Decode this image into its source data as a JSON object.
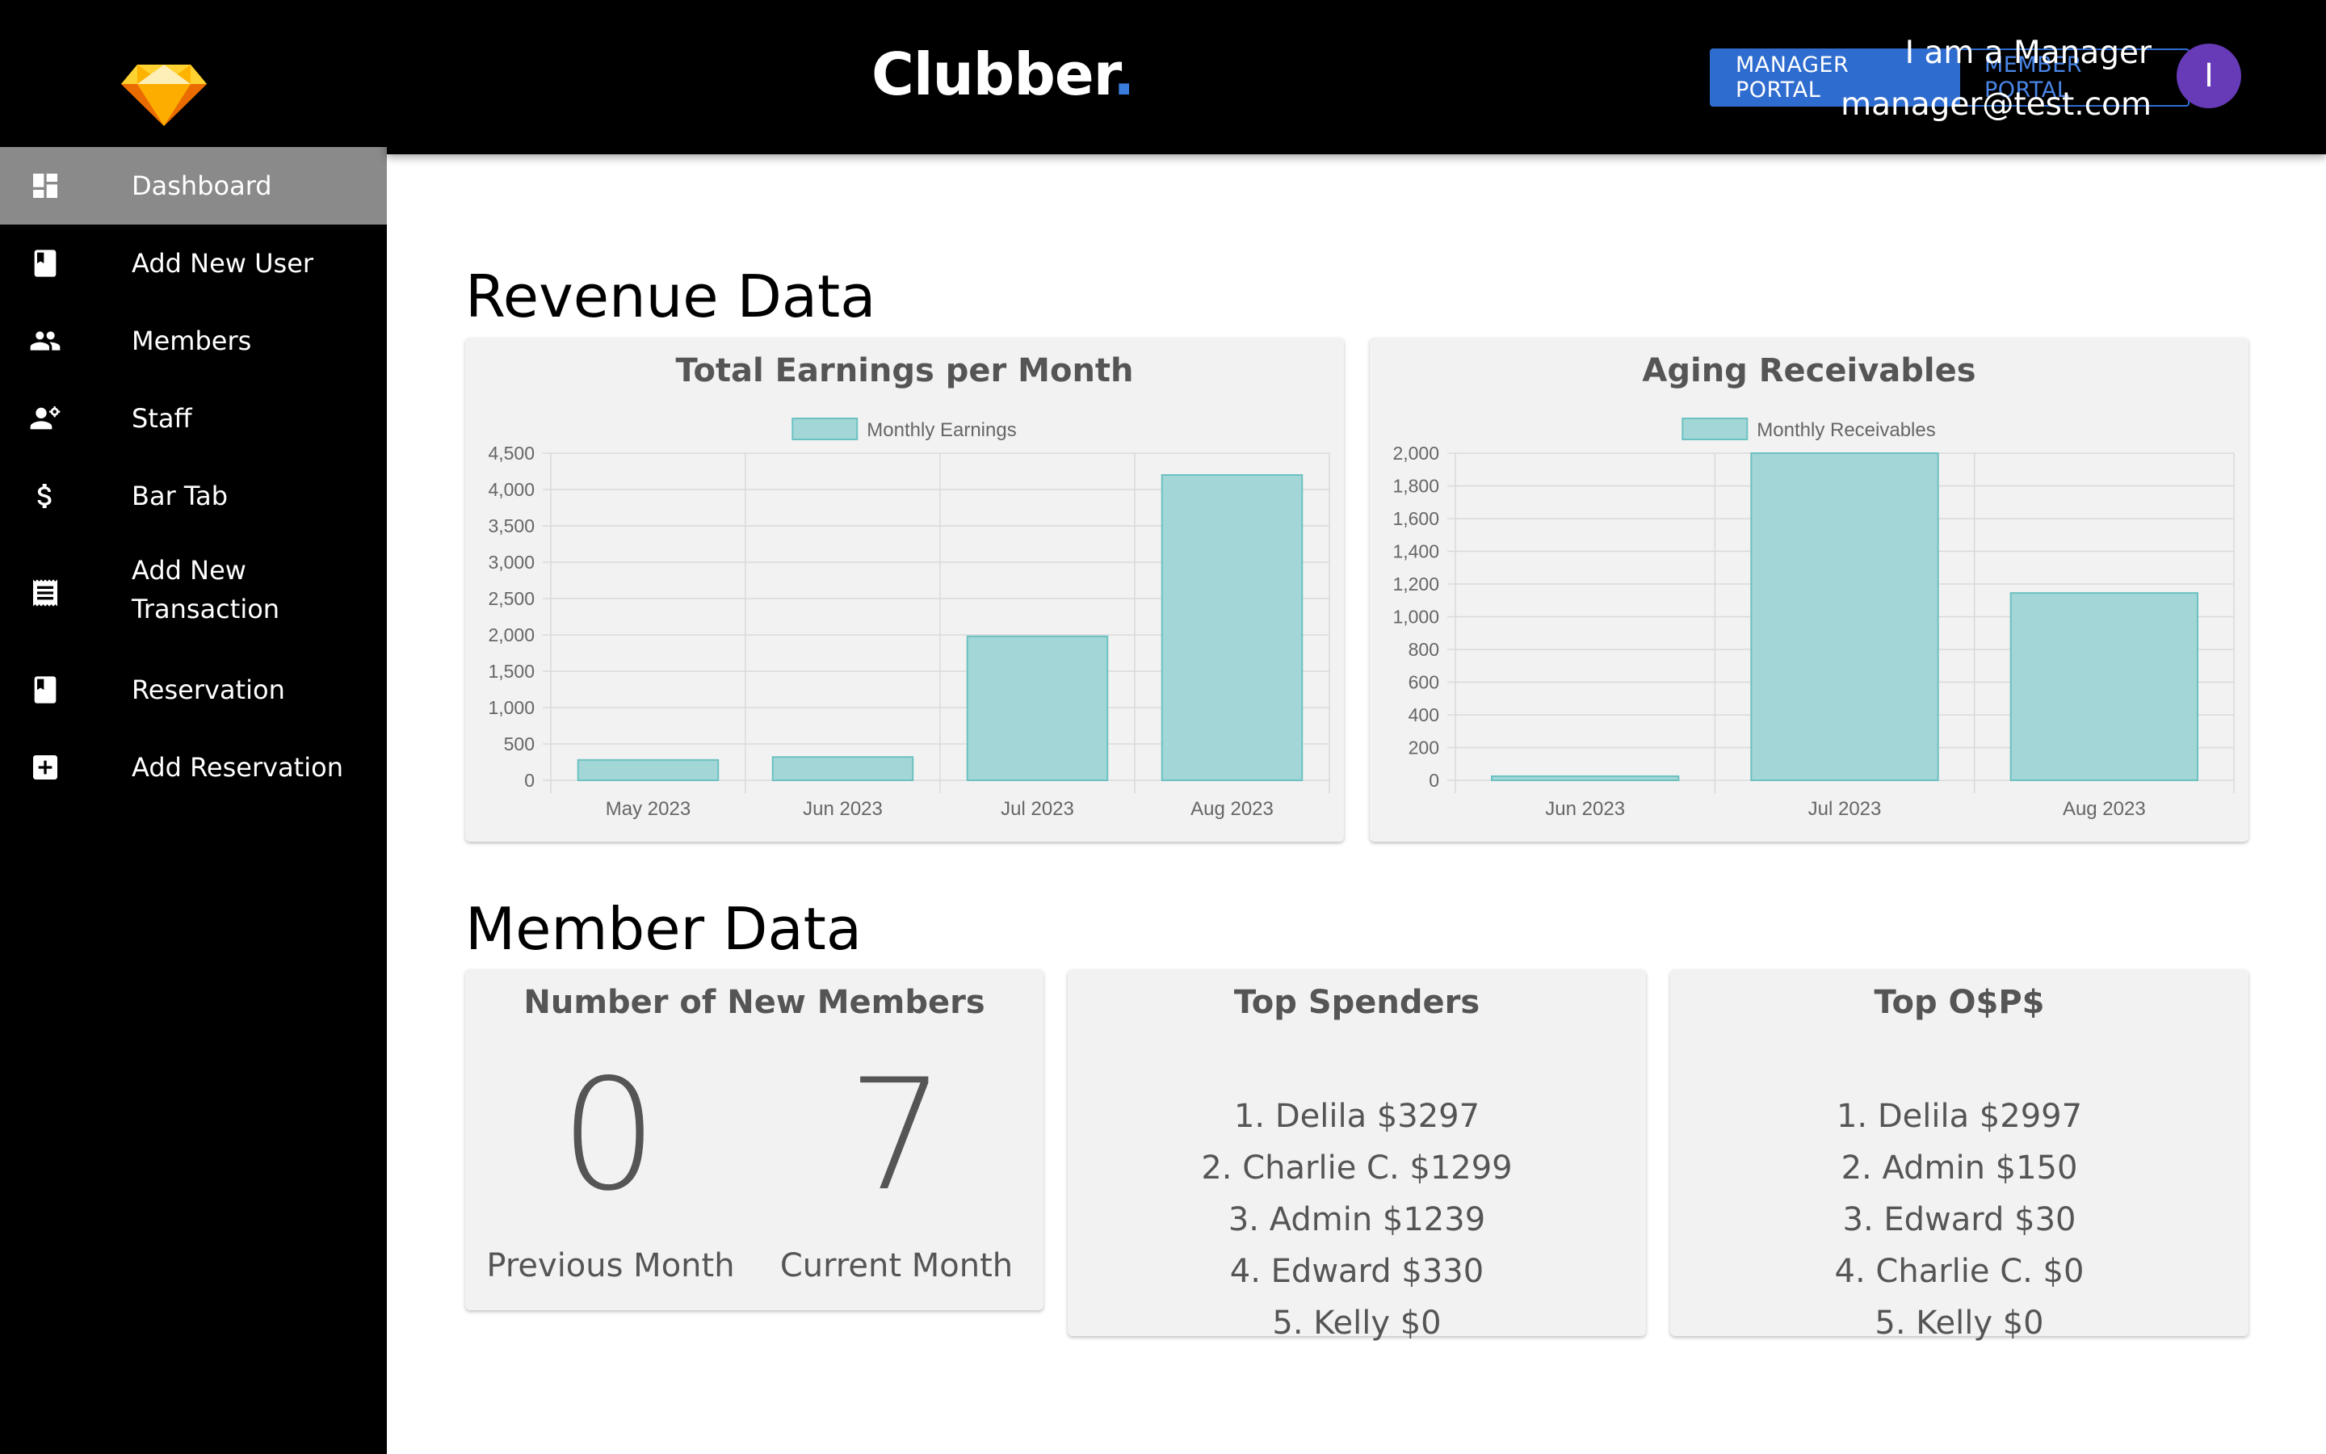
{
  "app": {
    "brand": "Clubber",
    "brand_dot": "."
  },
  "sidebar": {
    "items": [
      {
        "label": "Dashboard",
        "icon": "dashboard-icon",
        "active": true
      },
      {
        "label": "Add New User",
        "icon": "book-icon"
      },
      {
        "label": "Members",
        "icon": "people-icon"
      },
      {
        "label": "Staff",
        "icon": "staff-icon"
      },
      {
        "label": "Bar Tab",
        "icon": "dollar-icon"
      },
      {
        "label": "Add New",
        "label2": "Transaction",
        "icon": "receipt-icon"
      },
      {
        "label": "Reservation",
        "icon": "book-icon"
      },
      {
        "label": "Add Reservation",
        "icon": "plus-box-icon"
      }
    ]
  },
  "header": {
    "manager_portal": "MANAGER PORTAL",
    "member_portal": "MEMBER PORTAL",
    "user_name": "I am a Manager",
    "user_email": "manager@test.com",
    "avatar_initial": "I"
  },
  "colors": {
    "accent": "#2f6ccf",
    "avatar": "#673ab7",
    "bar_fill": "#a3d6d6",
    "bar_stroke": "#6cc1c1"
  },
  "revenue": {
    "section_title": "Revenue Data"
  },
  "member": {
    "section_title": "Member Data",
    "new_members": {
      "title": "Number of New Members",
      "previous_value": "0",
      "previous_label": "Previous Month",
      "current_value": "7",
      "current_label": "Current Month"
    },
    "top_spenders": {
      "title": "Top Spenders",
      "items": [
        "1. Delila $3297",
        "2. Charlie C. $1299",
        "3. Admin $1239",
        "4. Edward $330",
        "5. Kelly $0"
      ]
    },
    "top_osps": {
      "title": "Top O$P$",
      "items": [
        "1. Delila $2997",
        "2. Admin $150",
        "3. Edward $30",
        "4. Charlie C. $0",
        "5. Kelly $0"
      ]
    }
  },
  "chart_data": [
    {
      "type": "bar",
      "title": "Total Earnings per Month",
      "categories": [
        "May 2023",
        "Jun 2023",
        "Jul 2023",
        "Aug 2023"
      ],
      "series": [
        {
          "name": "Monthly Earnings",
          "values": [
            280,
            320,
            1980,
            4200
          ]
        }
      ],
      "ylim": [
        0,
        4500
      ],
      "yticks": [
        0,
        500,
        1000,
        1500,
        2000,
        2500,
        3000,
        3500,
        4000,
        4500
      ],
      "ytick_labels": [
        "0",
        "500",
        "1,000",
        "1,500",
        "2,000",
        "2,500",
        "3,000",
        "3,500",
        "4,000",
        "4,500"
      ],
      "legend": "top",
      "grid": true
    },
    {
      "type": "bar",
      "title": "Aging Receivables",
      "categories": [
        "Jun 2023",
        "Jul 2023",
        "Aug 2023"
      ],
      "series": [
        {
          "name": "Monthly Receivables",
          "values": [
            25,
            2000,
            1145
          ]
        }
      ],
      "ylim": [
        0,
        2000
      ],
      "yticks": [
        0,
        200,
        400,
        600,
        800,
        1000,
        1200,
        1400,
        1600,
        1800,
        2000
      ],
      "ytick_labels": [
        "0",
        "200",
        "400",
        "600",
        "800",
        "1,000",
        "1,200",
        "1,400",
        "1,600",
        "1,800",
        "2,000"
      ],
      "legend": "top",
      "grid": true
    }
  ]
}
